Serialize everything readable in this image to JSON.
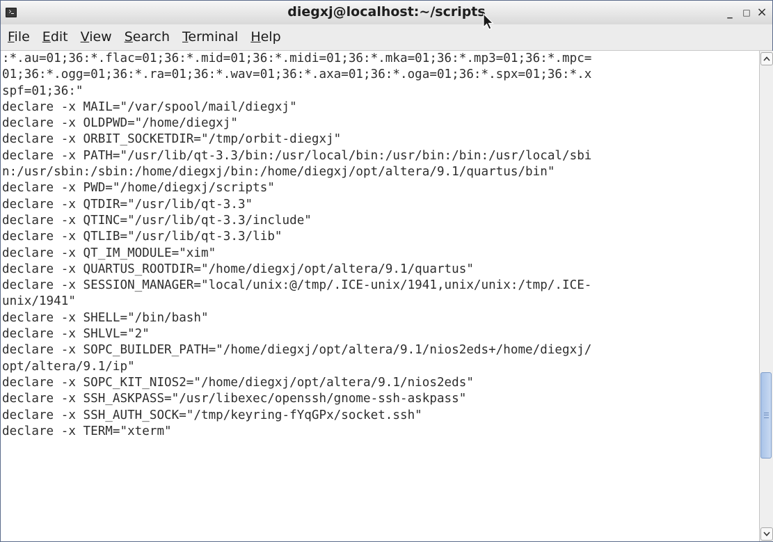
{
  "window": {
    "title": "diegxj@localhost:~/scripts",
    "controls": {
      "minimize": "_",
      "maximize": "□",
      "close": "×"
    }
  },
  "menubar": {
    "items": [
      {
        "mnemonic": "F",
        "rest": "ile"
      },
      {
        "mnemonic": "E",
        "rest": "dit"
      },
      {
        "mnemonic": "V",
        "rest": "iew"
      },
      {
        "mnemonic": "S",
        "rest": "earch"
      },
      {
        "mnemonic": "T",
        "rest": "erminal"
      },
      {
        "mnemonic": "H",
        "rest": "elp"
      }
    ]
  },
  "terminal": {
    "lines": [
      ":*.au=01;36:*.flac=01;36:*.mid=01;36:*.midi=01;36:*.mka=01;36:*.mp3=01;36:*.mpc=",
      "01;36:*.ogg=01;36:*.ra=01;36:*.wav=01;36:*.axa=01;36:*.oga=01;36:*.spx=01;36:*.x",
      "spf=01;36:\"",
      "declare -x MAIL=\"/var/spool/mail/diegxj\"",
      "declare -x OLDPWD=\"/home/diegxj\"",
      "declare -x ORBIT_SOCKETDIR=\"/tmp/orbit-diegxj\"",
      "declare -x PATH=\"/usr/lib/qt-3.3/bin:/usr/local/bin:/usr/bin:/bin:/usr/local/sbi",
      "n:/usr/sbin:/sbin:/home/diegxj/bin:/home/diegxj/opt/altera/9.1/quartus/bin\"",
      "declare -x PWD=\"/home/diegxj/scripts\"",
      "declare -x QTDIR=\"/usr/lib/qt-3.3\"",
      "declare -x QTINC=\"/usr/lib/qt-3.3/include\"",
      "declare -x QTLIB=\"/usr/lib/qt-3.3/lib\"",
      "declare -x QT_IM_MODULE=\"xim\"",
      "declare -x QUARTUS_ROOTDIR=\"/home/diegxj/opt/altera/9.1/quartus\"",
      "declare -x SESSION_MANAGER=\"local/unix:@/tmp/.ICE-unix/1941,unix/unix:/tmp/.ICE-",
      "unix/1941\"",
      "declare -x SHELL=\"/bin/bash\"",
      "declare -x SHLVL=\"2\"",
      "declare -x SOPC_BUILDER_PATH=\"/home/diegxj/opt/altera/9.1/nios2eds+/home/diegxj/",
      "opt/altera/9.1/ip\"",
      "declare -x SOPC_KIT_NIOS2=\"/home/diegxj/opt/altera/9.1/nios2eds\"",
      "declare -x SSH_ASKPASS=\"/usr/libexec/openssh/gnome-ssh-askpass\"",
      "declare -x SSH_AUTH_SOCK=\"/tmp/keyring-fYqGPx/socket.ssh\"",
      "declare -x TERM=\"xterm\""
    ]
  },
  "scrollbar": {
    "position_fraction": 0.82
  }
}
